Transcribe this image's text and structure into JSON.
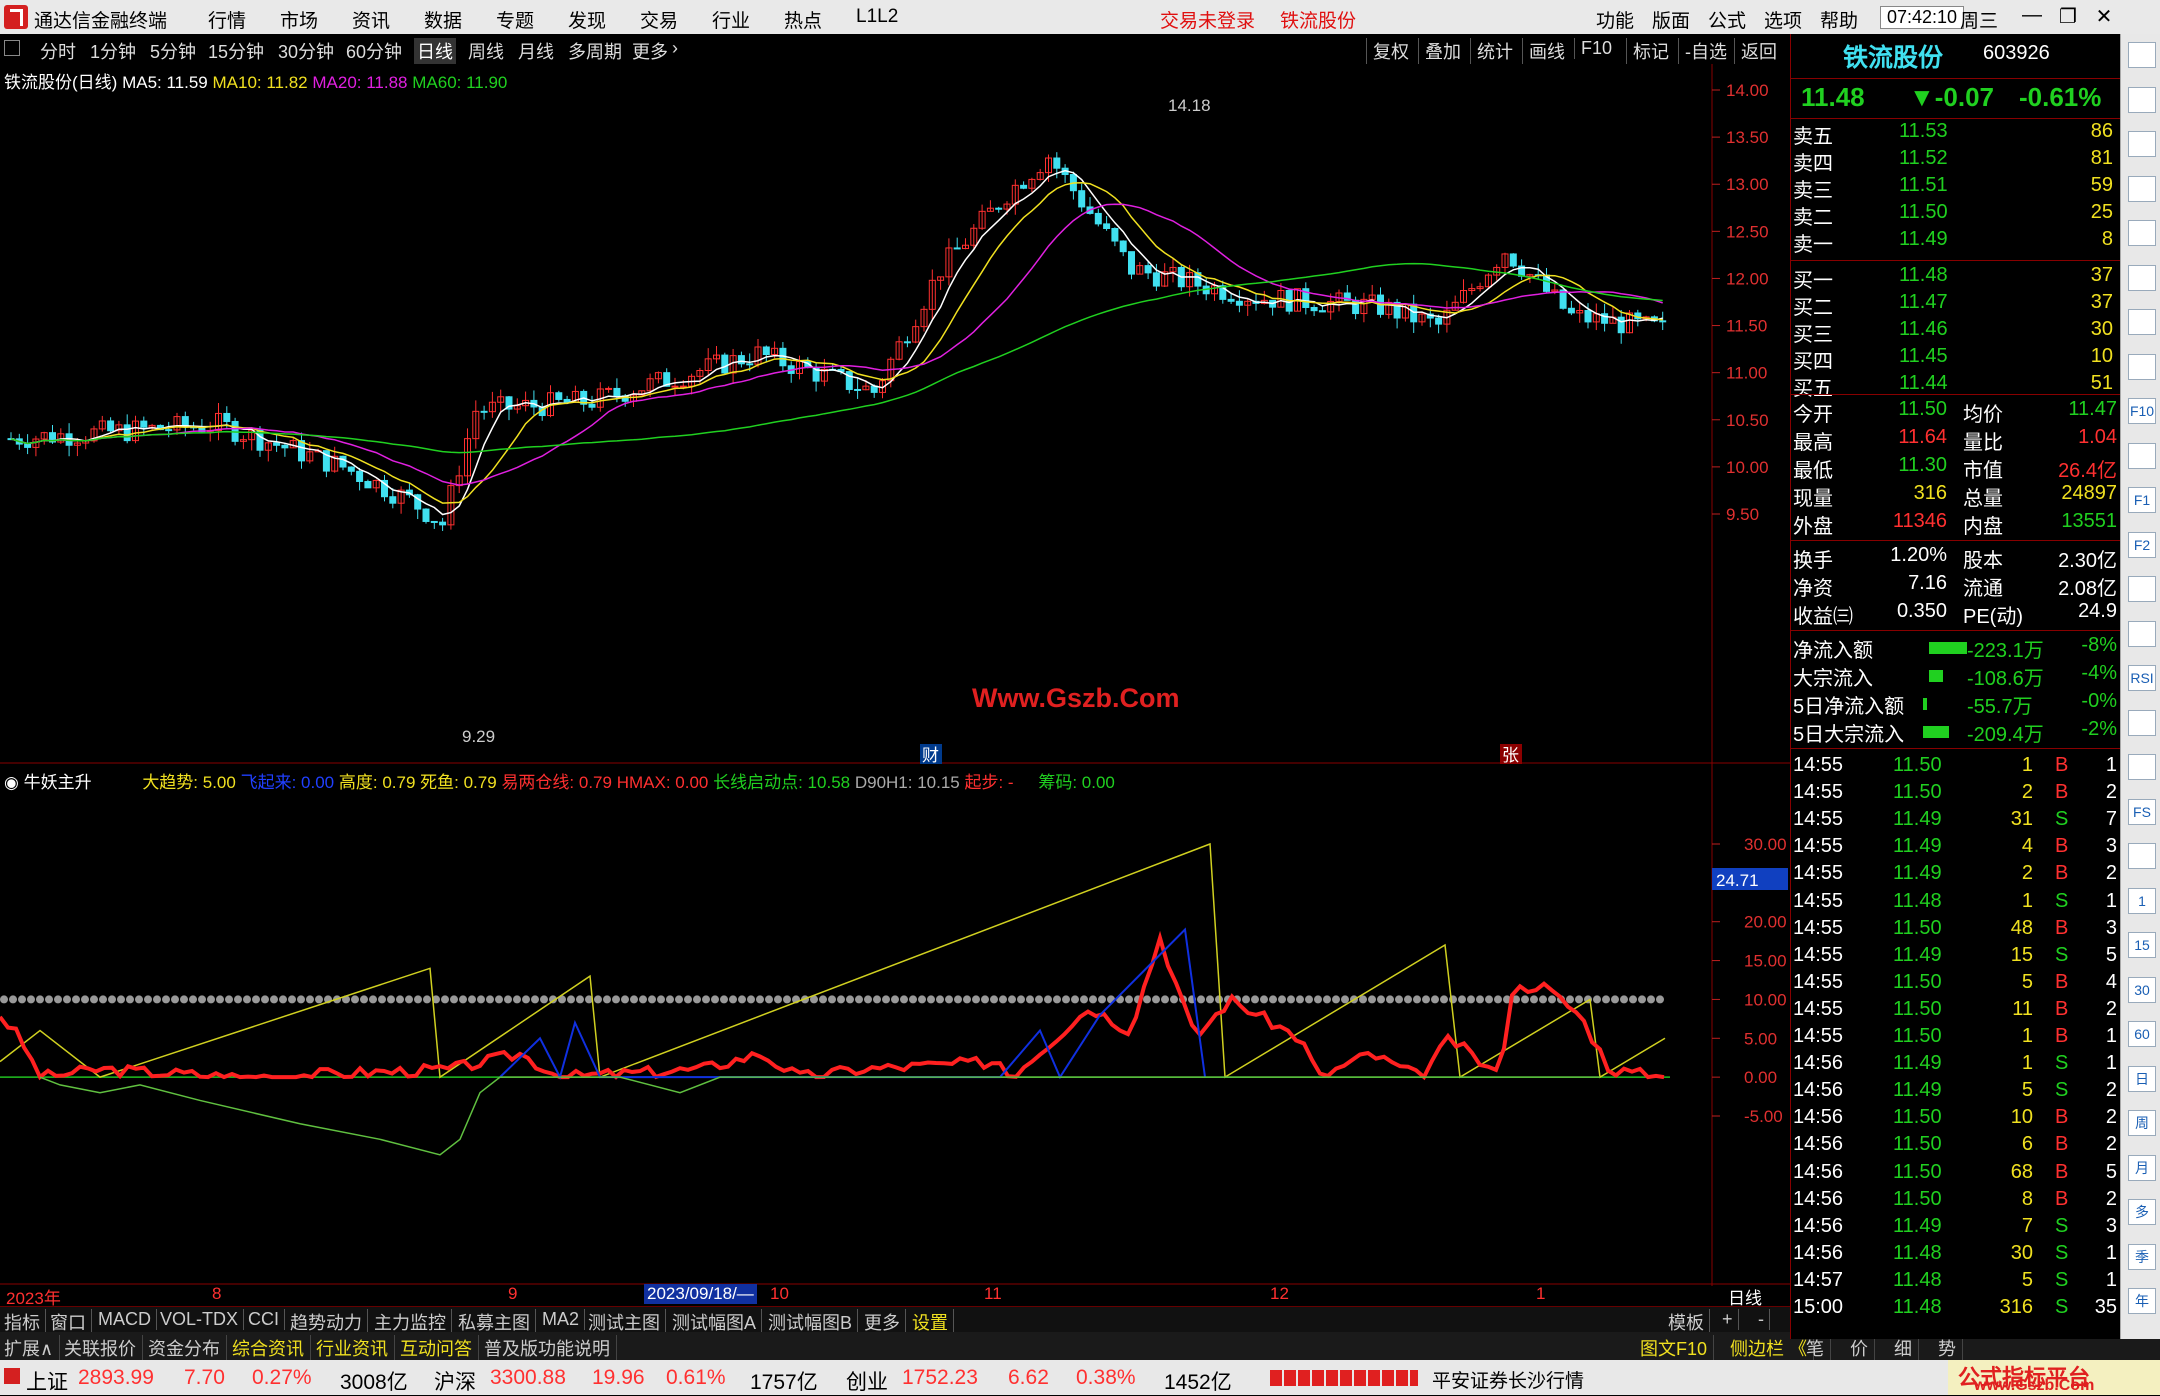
{
  "app": {
    "title": "通达信金融终端",
    "menus": [
      "行情",
      "市场",
      "资讯",
      "数据",
      "专题",
      "发现",
      "交易",
      "行业",
      "热点",
      "L1L2"
    ],
    "warning": "交易未登录",
    "warn_stock": "铁流股份",
    "right_menus": [
      "功能",
      "版面",
      "公式",
      "选项",
      "帮助"
    ],
    "clock": "07:42:10",
    "weekday": "周三",
    "win": [
      "—",
      "❐",
      "✕"
    ]
  },
  "period_tabs": [
    "分时",
    "1分钟",
    "5分钟",
    "15分钟",
    "30分钟",
    "60分钟",
    "日线",
    "周线",
    "月线",
    "多周期",
    "更多"
  ],
  "period_active": "日线",
  "right_tabs": [
    "复权",
    "叠加",
    "统计",
    "画线",
    "F10",
    "标记",
    "-自选",
    "返回"
  ],
  "main_legend": {
    "name": "铁流股份(日线)",
    "ma5": "MA5: 11.59",
    "ma10": "MA10: 11.82",
    "ma20": "MA20: 11.88",
    "ma60": "MA60: 11.90"
  },
  "main_axis": [
    "14.00",
    "13.50",
    "13.00",
    "12.50",
    "12.00",
    "11.50",
    "11.00",
    "10.50",
    "10.00",
    "9.50"
  ],
  "high_label": "14.18",
  "low_label": "9.29",
  "watermark": "Www.Gszb.Com",
  "markers": {
    "cai": "财",
    "zhang": "张"
  },
  "ind_legend": {
    "name": "牛妖主升",
    "dqs": "大趋势: 5.00",
    "fqa": "飞起来: 0.00",
    "gd": "高度: 0.79",
    "sy": "死鱼: 0.79",
    "yl": "易两仓线: 0.79",
    "hmax": "HMAX: 0.00",
    "cx": "长线启动点: 10.58",
    "d90": "D90H1: 10.15",
    "qb": "起步: -",
    "cm": "筹码: 0.00"
  },
  "ind_axis": [
    "30.00",
    "25.00",
    "20.00",
    "15.00",
    "10.00",
    "5.00",
    "0.00",
    "-5.00"
  ],
  "ind_current": "24.71",
  "time_axis": {
    "labels": [
      "2023年",
      "8",
      "9",
      "2023/09/18/—",
      "10",
      "11",
      "12",
      "1"
    ],
    "right": "日线"
  },
  "bottom_tabs1": [
    "指标",
    "窗口",
    "MACD",
    "VOL-TDX",
    "CCI",
    "趋势动力",
    "主力监控",
    "私募主图",
    "MA2",
    "测试主图",
    "测试幅图A",
    "测试幅图B",
    "更多",
    "设置"
  ],
  "bottom_tabs1_right": [
    "模板",
    "+",
    "-"
  ],
  "bottom_tabs2": [
    "扩展∧",
    "关联报价",
    "资金分布",
    "综合资讯",
    "行业资讯",
    "互动问答",
    "普及版功能说明"
  ],
  "bottom_tabs2_right": [
    "图文F10",
    "侧边栏 《",
    "笔",
    "价",
    "细",
    "势"
  ],
  "status": {
    "sh": {
      "name": "上证",
      "val": "2893.99",
      "chg": "7.70",
      "pct": "0.27%",
      "amt": "3008亿"
    },
    "sz": {
      "name": "沪深",
      "val": "3300.88",
      "chg": "19.96",
      "pct": "0.61%",
      "amt": "1757亿"
    },
    "cy": {
      "name": "创业",
      "val": "1752.23",
      "chg": "6.62",
      "pct": "0.38%",
      "amt": "1452亿"
    },
    "broker": "平安证券长沙行情",
    "brand": "公式指标平台",
    "brand_url": "www.Gszb.Com"
  },
  "quote": {
    "name": "铁流股份",
    "code": "603926",
    "price": "11.48",
    "chg": "▼-0.07",
    "pct": "-0.61%",
    "sells": [
      {
        "label": "卖五",
        "price": "11.53",
        "vol": "86"
      },
      {
        "label": "卖四",
        "price": "11.52",
        "vol": "81"
      },
      {
        "label": "卖三",
        "price": "11.51",
        "vol": "59"
      },
      {
        "label": "卖二",
        "price": "11.50",
        "vol": "25"
      },
      {
        "label": "卖一",
        "price": "11.49",
        "vol": "8"
      }
    ],
    "buys": [
      {
        "label": "买一",
        "price": "11.48",
        "vol": "37"
      },
      {
        "label": "买二",
        "price": "11.47",
        "vol": "37"
      },
      {
        "label": "买三",
        "price": "11.46",
        "vol": "30"
      },
      {
        "label": "买四",
        "price": "11.45",
        "vol": "10"
      },
      {
        "label": "买五",
        "price": "11.44",
        "vol": "51"
      }
    ],
    "stats": [
      {
        "l1": "今开",
        "v1": "11.50",
        "l2": "均价",
        "v2": "11.47"
      },
      {
        "l1": "最高",
        "v1": "11.64",
        "l2": "量比",
        "v2": "1.04"
      },
      {
        "l1": "最低",
        "v1": "11.30",
        "l2": "市值",
        "v2": "26.4亿"
      },
      {
        "l1": "现量",
        "v1": "316",
        "l2": "总量",
        "v2": "24897"
      },
      {
        "l1": "外盘",
        "v1": "11346",
        "l2": "内盘",
        "v2": "13551"
      }
    ],
    "stats2": [
      {
        "l1": "换手",
        "v1": "1.20%",
        "l2": "股本",
        "v2": "2.30亿"
      },
      {
        "l1": "净资",
        "v1": "7.16",
        "l2": "流通",
        "v2": "2.08亿"
      },
      {
        "l1": "收益㈢",
        "v1": "0.350",
        "l2": "PE(动)",
        "v2": "24.9"
      }
    ],
    "flows": [
      {
        "label": "净流入额",
        "amt": "-223.1万",
        "pct": "-8%"
      },
      {
        "label": "大宗流入",
        "amt": "-108.6万",
        "pct": "-4%"
      },
      {
        "label": "5日净流入额",
        "amt": "-55.7万",
        "pct": "-0%"
      },
      {
        "label": "5日大宗流入",
        "amt": "-209.4万",
        "pct": "-2%"
      }
    ],
    "ticks": [
      {
        "t": "14:55",
        "p": "11.50",
        "v": "1",
        "d": "B",
        "n": "1"
      },
      {
        "t": "14:55",
        "p": "11.50",
        "v": "2",
        "d": "B",
        "n": "2"
      },
      {
        "t": "14:55",
        "p": "11.49",
        "v": "31",
        "d": "S",
        "n": "7"
      },
      {
        "t": "14:55",
        "p": "11.49",
        "v": "4",
        "d": "B",
        "n": "3"
      },
      {
        "t": "14:55",
        "p": "11.49",
        "v": "2",
        "d": "B",
        "n": "2"
      },
      {
        "t": "14:55",
        "p": "11.48",
        "v": "1",
        "d": "S",
        "n": "1"
      },
      {
        "t": "14:55",
        "p": "11.50",
        "v": "48",
        "d": "B",
        "n": "3"
      },
      {
        "t": "14:55",
        "p": "11.49",
        "v": "15",
        "d": "S",
        "n": "5"
      },
      {
        "t": "14:55",
        "p": "11.50",
        "v": "5",
        "d": "B",
        "n": "4"
      },
      {
        "t": "14:55",
        "p": "11.50",
        "v": "11",
        "d": "B",
        "n": "2"
      },
      {
        "t": "14:55",
        "p": "11.50",
        "v": "1",
        "d": "B",
        "n": "1"
      },
      {
        "t": "14:56",
        "p": "11.49",
        "v": "1",
        "d": "S",
        "n": "1"
      },
      {
        "t": "14:56",
        "p": "11.49",
        "v": "5",
        "d": "S",
        "n": "2"
      },
      {
        "t": "14:56",
        "p": "11.50",
        "v": "10",
        "d": "B",
        "n": "2"
      },
      {
        "t": "14:56",
        "p": "11.50",
        "v": "6",
        "d": "B",
        "n": "2"
      },
      {
        "t": "14:56",
        "p": "11.50",
        "v": "68",
        "d": "B",
        "n": "5"
      },
      {
        "t": "14:56",
        "p": "11.50",
        "v": "8",
        "d": "B",
        "n": "2"
      },
      {
        "t": "14:56",
        "p": "11.49",
        "v": "7",
        "d": "S",
        "n": "3"
      },
      {
        "t": "14:56",
        "p": "11.48",
        "v": "30",
        "d": "S",
        "n": "1"
      },
      {
        "t": "14:57",
        "p": "11.48",
        "v": "5",
        "d": "S",
        "n": "1"
      },
      {
        "t": "15:00",
        "p": "11.48",
        "v": "316",
        "d": "S",
        "n": "35"
      }
    ]
  },
  "icon_strip": [
    "up-arrow-icon",
    "up-icon",
    "down-icon",
    "list-icon",
    "grid-icon",
    "chart-icon",
    "candle-icon",
    "table-icon",
    "f10-icon",
    "doc-icon",
    "f1-icon",
    "f2-icon",
    "circle-icon",
    "wave-icon",
    "rsi-icon",
    "move-icon",
    "pen-icon",
    "fs-icon",
    "vol-icon",
    "one-icon",
    "fifteen-icon",
    "thirty-icon",
    "sixty-icon",
    "day-icon",
    "week-icon",
    "month-icon",
    "multi-icon",
    "season-icon",
    "year-icon"
  ],
  "icon_labels": [
    "",
    "",
    "",
    "",
    "",
    "",
    "",
    "",
    "F10",
    "",
    "F1",
    "F2",
    "",
    "",
    "RSI",
    "",
    "",
    "FS",
    "",
    "1",
    "15",
    "30",
    "60",
    "日",
    "周",
    "月",
    "多",
    "季",
    "年"
  ]
}
